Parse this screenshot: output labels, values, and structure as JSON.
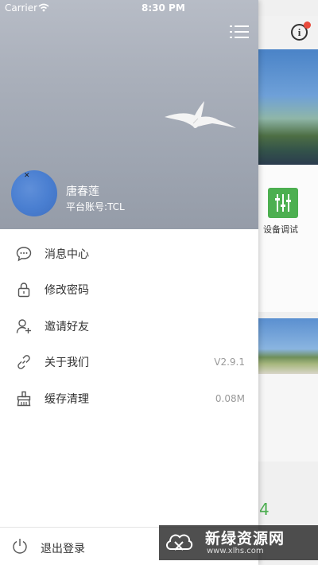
{
  "status_bar": {
    "carrier": "Carrier",
    "time": "8:30 PM"
  },
  "background_app": {
    "tile_label": "设备调试",
    "partial_number": "4"
  },
  "profile": {
    "name": "唐春莲",
    "account": "平台账号:TCL"
  },
  "menu": [
    {
      "label": "消息中心",
      "icon": "chat-bubble-icon",
      "value": ""
    },
    {
      "label": "修改密码",
      "icon": "lock-icon",
      "value": ""
    },
    {
      "label": "邀请好友",
      "icon": "add-user-icon",
      "value": ""
    },
    {
      "label": "关于我们",
      "icon": "link-icon",
      "value": "V2.9.1"
    },
    {
      "label": "缓存清理",
      "icon": "broom-icon",
      "value": "0.08M"
    }
  ],
  "logout": {
    "label": "退出登录"
  },
  "watermark": {
    "title": "新绿资源网",
    "url": "www.xlhs.com"
  },
  "colors": {
    "accent_green": "#4caf50",
    "badge_red": "#e94b3c",
    "header_bg": "#a9afba"
  }
}
